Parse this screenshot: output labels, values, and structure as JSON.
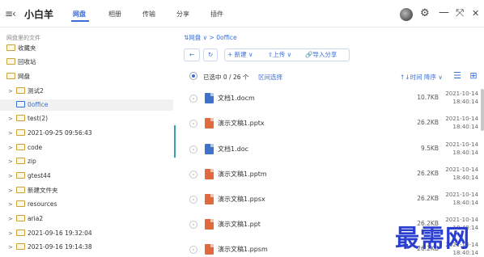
{
  "header": {
    "menu_icon": "≡‹",
    "app_title": "小白羊",
    "tabs": [
      {
        "label": "网盘",
        "active": true
      },
      {
        "label": "相册",
        "active": false
      },
      {
        "label": "传输",
        "active": false
      },
      {
        "label": "分享",
        "active": false
      },
      {
        "label": "插件",
        "active": false
      }
    ],
    "icons": {
      "settings": "⚙",
      "minimize": "—",
      "maximize": "⤧",
      "close": "✕"
    }
  },
  "sidebar": {
    "caption": "网盘里的文件",
    "items": [
      {
        "label": "收藏夹",
        "arrow": ""
      },
      {
        "label": "回收站",
        "arrow": ""
      },
      {
        "label": "网盘",
        "arrow": ""
      },
      {
        "label": "测试2",
        "arrow": ">"
      },
      {
        "label": "0office",
        "arrow": "",
        "selected": true
      },
      {
        "label": "test(2)",
        "arrow": ">"
      },
      {
        "label": "2021-09-25 09:56:43",
        "arrow": ">"
      },
      {
        "label": "code",
        "arrow": ">"
      },
      {
        "label": "zip",
        "arrow": ">"
      },
      {
        "label": "gtest44",
        "arrow": ">"
      },
      {
        "label": "新建文件夹",
        "arrow": ">"
      },
      {
        "label": "resources",
        "arrow": ">"
      },
      {
        "label": "aria2",
        "arrow": ">"
      },
      {
        "label": "2021-09-16 19:32:04",
        "arrow": ">"
      },
      {
        "label": "2021-09-16 19:14:38",
        "arrow": ">"
      }
    ]
  },
  "main": {
    "breadcrumb": "⇅网盘 ∨ > 0office",
    "toolbar": {
      "back": "←",
      "refresh": "↻",
      "new": "+ 新建 ∨",
      "upload": "⇧上传 ∨",
      "import": "🔗导入分享"
    },
    "selection": {
      "text": "已选中 0 / 26 个",
      "range_select": "区间选择",
      "sort": "↑↓时间 降序 ∨",
      "list_view_icon": "☰",
      "grid_view_icon": "⊞"
    },
    "files": [
      {
        "name": "文档1.docm",
        "type": "doc",
        "size": "10.7KB",
        "date": "2021-10-14",
        "time": "18:40:14"
      },
      {
        "name": "演示文稿1.pptx",
        "type": "ppt",
        "size": "26.2KB",
        "date": "2021-10-14",
        "time": "18:40:14"
      },
      {
        "name": "文档1.doc",
        "type": "doc",
        "size": "9.5KB",
        "date": "2021-10-14",
        "time": "18:40:14"
      },
      {
        "name": "演示文稿1.pptm",
        "type": "ppt",
        "size": "26.2KB",
        "date": "2021-10-14",
        "time": "18:40:14"
      },
      {
        "name": "演示文稿1.ppsx",
        "type": "ppt",
        "size": "26.2KB",
        "date": "2021-10-14",
        "time": "18:40:14"
      },
      {
        "name": "演示文稿1.ppt",
        "type": "ppt",
        "size": "26.2KB",
        "date": "2021-10-14",
        "time": "18:40:14"
      },
      {
        "name": "演示文稿1.ppsm",
        "type": "ppt",
        "size": "26.2KB",
        "date": "2021-10-14",
        "time": "18:40:14"
      }
    ]
  },
  "watermark": "最需网"
}
